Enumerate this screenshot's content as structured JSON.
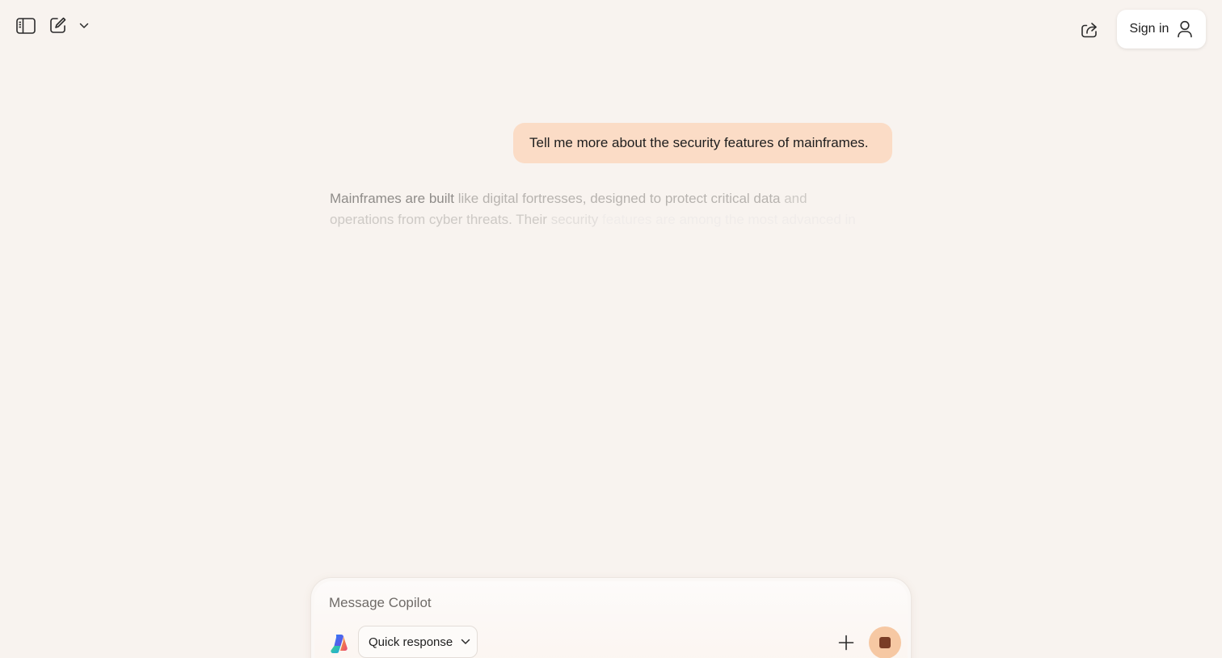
{
  "header": {
    "sign_in_label": "Sign in"
  },
  "conversation": {
    "user_message": "Tell me more about the security features of mainframes.",
    "assistant_response": {
      "line1": {
        "a": "Mainframes are built",
        "b": " like digital fortresses, designed to protect critical data",
        "c": " and"
      },
      "line2": {
        "a": "operations from cyber threats. Their",
        "b": " security",
        "c": " features are",
        "d": " among",
        "e": " the most advanced in"
      }
    }
  },
  "composer": {
    "placeholder": "Message Copilot",
    "mode_label": "Quick response"
  },
  "colors": {
    "background": "#f8f3ef",
    "user_bubble": "#fbdcc6",
    "stop_button": "#f6c8a3",
    "stop_icon": "#7a3d26"
  },
  "icons": {
    "sidebar_toggle": "sidebar-icon",
    "new_chat": "compose-icon",
    "new_chat_menu": "chevron-down-icon",
    "share": "share-icon",
    "user": "person-icon",
    "logo": "copilot-logo-icon",
    "add": "plus-icon",
    "stop": "stop-icon"
  }
}
